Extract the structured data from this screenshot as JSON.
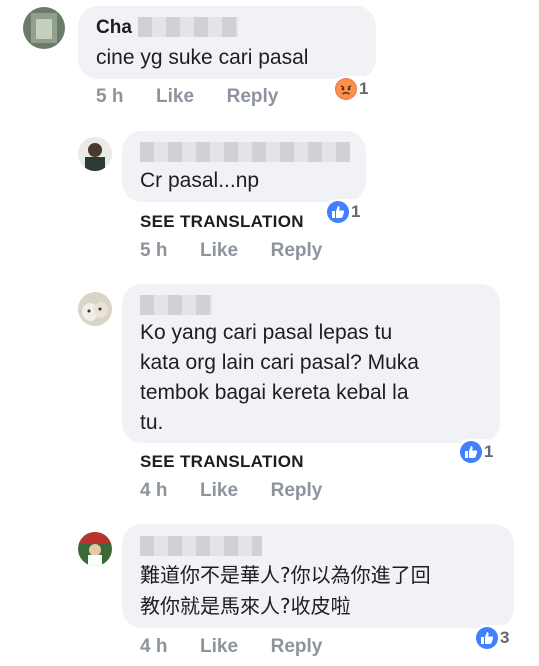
{
  "comments": [
    {
      "name_visible": "Cha",
      "text_lines": [
        "cine yg suke cari pasal"
      ],
      "time": "5 h",
      "like": "Like",
      "reply": "Reply",
      "reaction": {
        "icon": "angry-icon",
        "count": "1"
      }
    },
    {
      "name_visible": "",
      "text_lines": [
        "Cr pasal...np"
      ],
      "see_translation": "SEE TRANSLATION",
      "time": "5 h",
      "like": "Like",
      "reply": "Reply",
      "reaction": {
        "icon": "like-icon",
        "count": "1"
      }
    },
    {
      "name_visible": "",
      "text_lines": [
        "Ko yang cari pasal lepas tu",
        "kata org lain cari pasal? Muka",
        "tembok bagai kereta kebal la",
        "tu."
      ],
      "see_translation": "SEE TRANSLATION",
      "time": "4 h",
      "like": "Like",
      "reply": "Reply",
      "reaction": {
        "icon": "like-icon",
        "count": "1"
      }
    },
    {
      "name_visible": "",
      "text_lines": [
        "難道你不是華人?你以為你進了回",
        "教你就是馬來人?收皮啦"
      ],
      "time": "4 h",
      "like": "Like",
      "reply": "Reply",
      "reaction": {
        "icon": "like-icon",
        "count": "3"
      }
    }
  ],
  "colors": {
    "like_blue": "#4080ff",
    "angry_orange": "#f7714c",
    "meta_gray": "#8d949e"
  }
}
